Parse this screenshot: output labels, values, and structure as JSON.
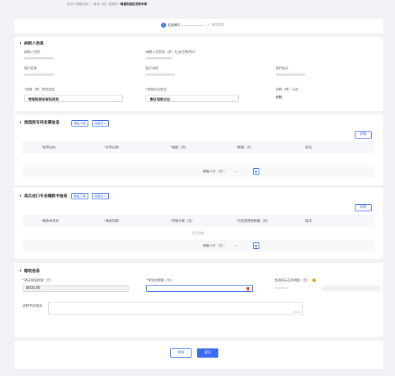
{
  "breadcrumb": [
    "首页",
    "我要办税",
    "一般退（抵）税管理",
    "增值税留抵退税申请"
  ],
  "steps": [
    {
      "num": "1",
      "label": "信息填写",
      "active": true
    },
    {
      "num": "2",
      "label": "提交成功",
      "active": false
    }
  ],
  "taxpayer": {
    "title": "纳税人信息",
    "name_label": "纳税人名称",
    "id_label": "纳税人识别号（统一社会信用代码）",
    "bank_label": "银行名称",
    "account_name_label": "账户名称",
    "account_no_label": "银行账号",
    "refund_reason_label": "退税（费）原因类型",
    "refund_reason_value": "增值税期末留抵退税",
    "enterprise_type_label": "退税企业类型",
    "enterprise_type_value": "集成电路企业",
    "method_label": "退税（费）方式",
    "method_value": "退税"
  },
  "vat_invoice": {
    "title": "增值税专用发票信息",
    "template_btn": "模板下载",
    "import_btn": "批量导入",
    "add_btn": "新增",
    "columns": [
      "发票号码",
      "开票日期",
      "金额（元）",
      "税额（元）",
      "操作"
    ],
    "subtotal_label": "税额小计（元）：",
    "subtotal_value": "--"
  },
  "customs": {
    "title": "海关进口专用缴款书信息",
    "template_btn": "模板下载",
    "import_btn": "批量导入",
    "add_btn": "新增",
    "columns": [
      "缴款书号码",
      "填发日期",
      "完税价格（元）",
      "代征增值税税额（元）",
      "操作"
    ],
    "empty_text": "暂无数据",
    "subtotal_label": "税额小计（元）：",
    "subtotal_value": "--"
  },
  "collection": {
    "title": "缴收信息",
    "period_end_label": "期末留抵税额（元）",
    "period_end_value": "8000.00",
    "apply_label": "申请退税额（元）",
    "apply_value": "",
    "current_label": "当期期末应退税额（元）",
    "reason_label": "退税申请理由",
    "reason_counter": "0/300"
  },
  "footer": {
    "save": "保存",
    "submit": "提交"
  },
  "colors": {
    "primary": "#3a6cf4",
    "required": "#e53935",
    "warning": "#f0a020"
  }
}
